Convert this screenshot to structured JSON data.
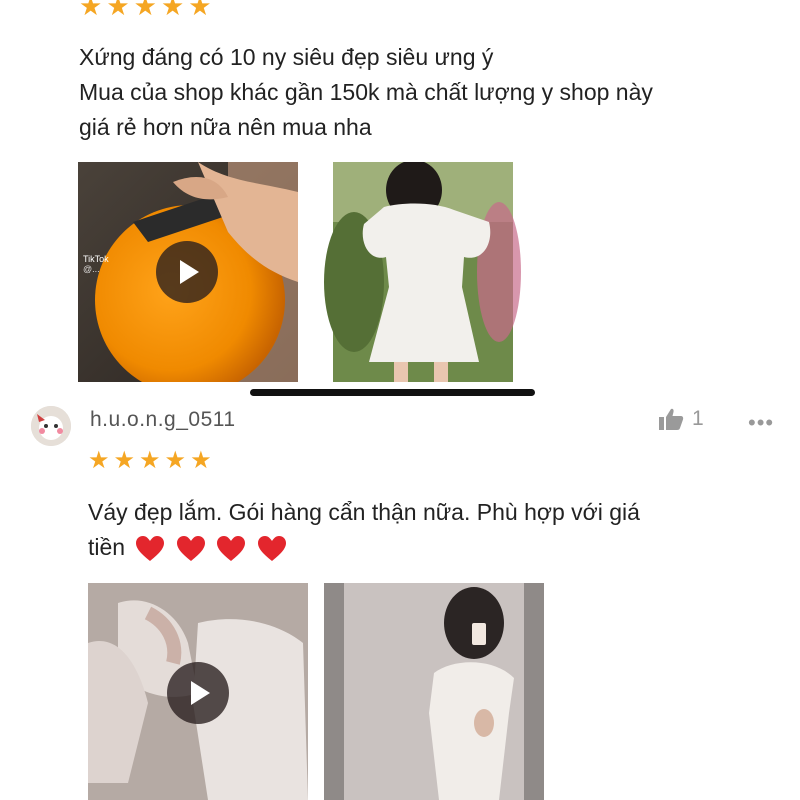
{
  "review1": {
    "stars": 5,
    "lines": [
      "Xứng đáng có 10 ny siêu đẹp siêu ưng ý",
      "Mua của shop khác gần 150k mà chất lượng y shop này",
      "giá rẻ hơn nữa nên mua nha"
    ],
    "video_watermark": "TikTok",
    "video_watermark_handle": "@..."
  },
  "review2": {
    "username": "h.u.o.n.g_0511",
    "likes": "1",
    "more": "•••",
    "stars": 5,
    "text_line1": "Váy đẹp lắm. Gói hàng cẩn thận nữa. Phù hợp với giá",
    "text_line2": "tiền"
  },
  "icons": {
    "star": "star-icon",
    "like": "thumbs-up-icon",
    "play": "play-icon",
    "heart": "heart-icon",
    "more": "more-options-icon"
  },
  "colors": {
    "star": "#f5a623",
    "heart": "#e3262d",
    "scrollbar": "#111111",
    "muted": "#999999"
  }
}
